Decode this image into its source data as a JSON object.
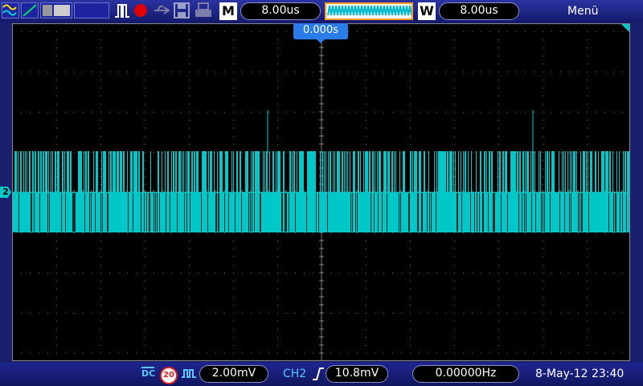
{
  "toolbar": {
    "mode_label": "M",
    "timebase": "8.00us",
    "window_label": "W",
    "window_timebase": "8.00us",
    "menu": "Menü",
    "icons": [
      "math-wave-icon",
      "ref-wave-icon",
      "channel-pattern-icon",
      "blank-slot",
      "pulse-trigger-icon",
      "record-icon",
      "usb-icon",
      "save-icon",
      "print-icon",
      "memory-wave-icon"
    ]
  },
  "waveform": {
    "trigger_offset": "0.000s",
    "channel_marker": "2",
    "trace_color": "#00c8c8"
  },
  "statusbar": {
    "coupling": "DC",
    "bw_limit": "20",
    "volts_div": "2.00mV",
    "trigger_source": "CH2",
    "trigger_level": "10.8mV",
    "frequency": "0.00000Hz",
    "datetime": "8-May-12 23:40"
  },
  "colors": {
    "accent": "#00c8c8",
    "trigger_marker": "#2a7de8",
    "record": "#e00000"
  }
}
